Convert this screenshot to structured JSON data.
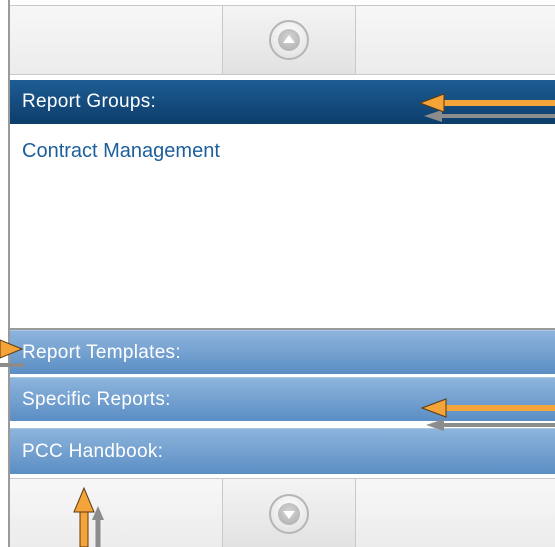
{
  "sections": {
    "report_groups": "Report Groups:",
    "report_templates": "Report Templates:",
    "specific_reports": "Specific Reports:",
    "pcc_handbook": "PCC Handbook:"
  },
  "report_groups_items": [
    "Contract Management"
  ],
  "icons": {
    "scroll_up": "scroll-up-icon",
    "scroll_down": "scroll-down-icon",
    "annotation_arrow": "arrow-icon"
  },
  "colors": {
    "active_header": "#0c3d6b",
    "inactive_header": "#5b8ec4",
    "link_text": "#1d5f9c",
    "arrow_orange": "#f5a43a",
    "arrow_gray": "#8c8c8c"
  }
}
